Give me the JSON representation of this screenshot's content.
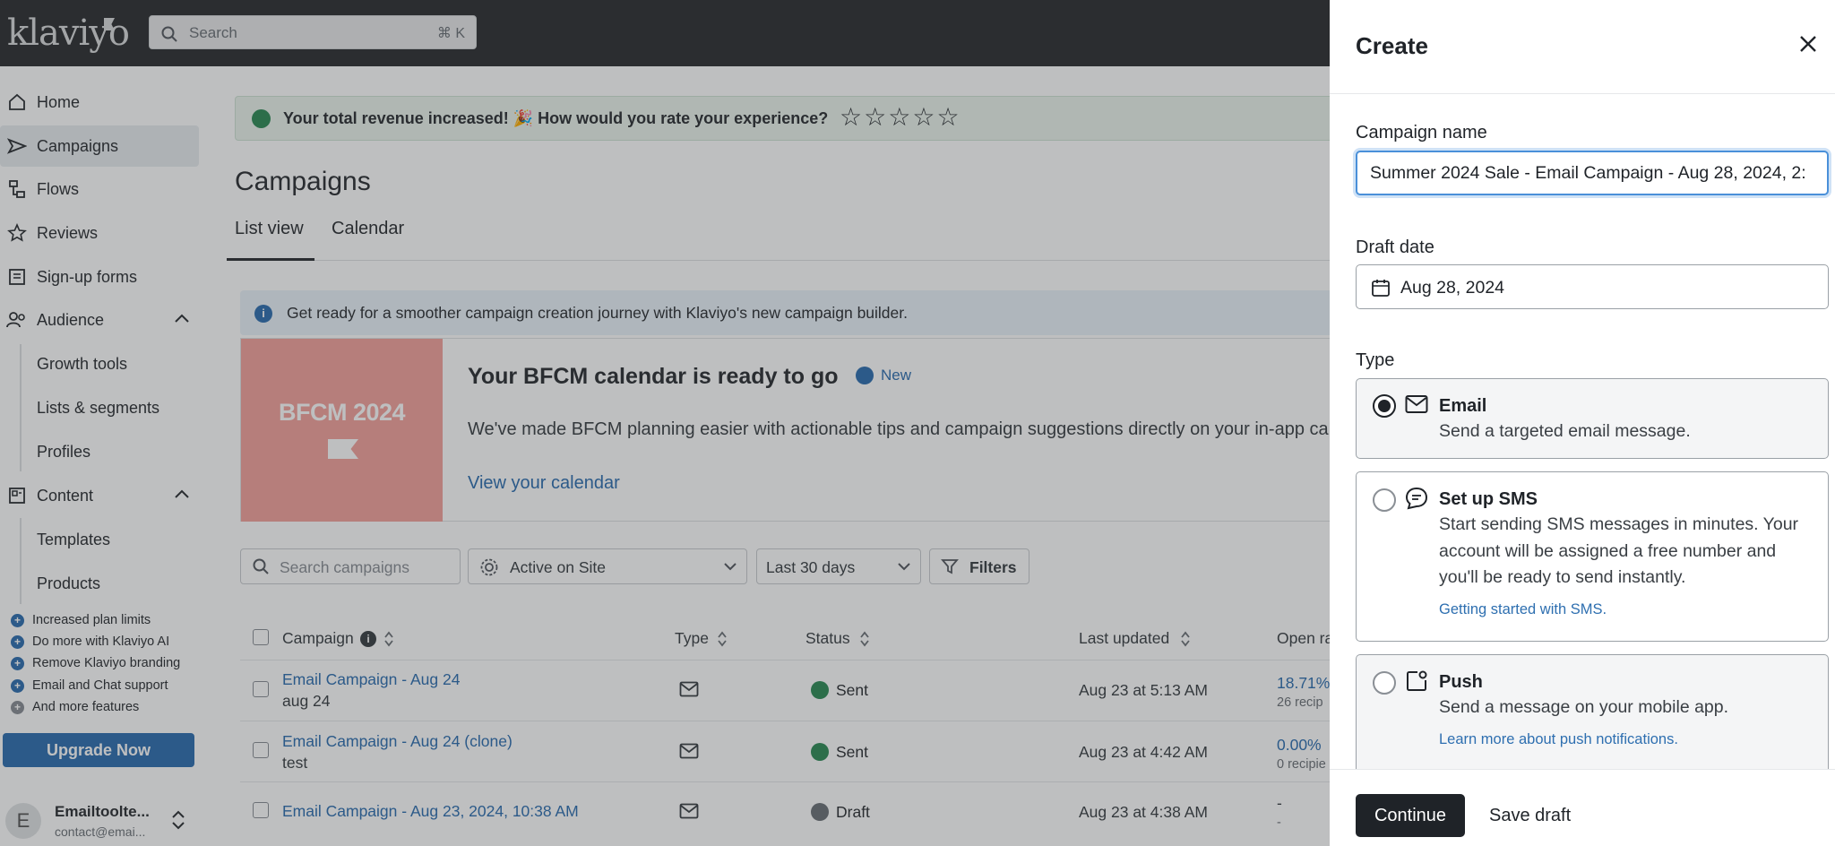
{
  "app": {
    "logo": "klaviyo",
    "search_placeholder": "Search",
    "search_shortcut": "⌘ K"
  },
  "sidebar": {
    "items": [
      {
        "label": "Home",
        "icon": "home-icon"
      },
      {
        "label": "Campaigns",
        "icon": "campaigns-icon"
      },
      {
        "label": "Flows",
        "icon": "flows-icon"
      },
      {
        "label": "Reviews",
        "icon": "star-icon"
      },
      {
        "label": "Sign-up forms",
        "icon": "form-icon"
      },
      {
        "label": "Audience",
        "icon": "audience-icon"
      },
      {
        "label": "Content",
        "icon": "content-icon"
      }
    ],
    "audience_sub": [
      "Growth tools",
      "Lists & segments",
      "Profiles"
    ],
    "content_sub": [
      "Templates",
      "Products"
    ],
    "perks": [
      "Increased plan limits",
      "Do more with Klaviyo AI",
      "Remove Klaviyo branding",
      "Email and Chat support",
      "And more features"
    ],
    "upgrade_label": "Upgrade Now",
    "account": {
      "initial": "E",
      "name": "Emailtoolte...",
      "email": "contact@emai..."
    }
  },
  "main": {
    "toast": "Your total revenue increased! 🎉 How would you rate your experience?",
    "stars": [
      "☆",
      "☆",
      "☆",
      "☆",
      "☆"
    ],
    "title": "Campaigns",
    "tabs": [
      "List view",
      "Calendar"
    ],
    "info_banner": "Get ready for a smoother campaign creation journey with Klaviyo's new campaign builder.",
    "bfcm": {
      "image_text": "BFCM 2024",
      "title": "Your BFCM calendar is ready to go",
      "badge": "New",
      "description": "We've made BFCM planning easier with actionable tips and campaign suggestions directly on your in-app cal",
      "link": "View your calendar"
    },
    "filters": {
      "search_placeholder": "Search campaigns",
      "channel": "Active on Site",
      "range": "Last 30 days",
      "filters_label": "Filters"
    },
    "columns": [
      "Campaign",
      "Type",
      "Status",
      "Last updated",
      "Open ra"
    ],
    "rows": [
      {
        "name": "Email Campaign - Aug 24",
        "sub": "aug 24",
        "status": "Sent",
        "updated": "Aug 23 at 5:13 AM",
        "open": "18.71%",
        "open_sub": "26 recip"
      },
      {
        "name": "Email Campaign - Aug 24 (clone)",
        "sub": "test",
        "status": "Sent",
        "updated": "Aug 23 at 4:42 AM",
        "open": "0.00%",
        "open_sub": "0 recipie"
      },
      {
        "name": "Email Campaign - Aug 23, 2024, 10:38 AM",
        "sub": "",
        "status": "Draft",
        "updated": "Aug 23 at 4:38 AM",
        "open": "-",
        "open_sub": "-"
      }
    ]
  },
  "panel": {
    "title": "Create",
    "campaign_name_label": "Campaign name",
    "campaign_name_value": "Summer 2024 Sale - Email Campaign - Aug 28, 2024, 2:",
    "draft_date_label": "Draft date",
    "draft_date_value": "Aug 28, 2024",
    "type_label": "Type",
    "options": [
      {
        "title": "Email",
        "desc": "Send a targeted email message.",
        "link": "",
        "selected": true
      },
      {
        "title": "Set up SMS",
        "desc": "Start sending SMS messages in minutes. Your account will be assigned a free number and you'll be ready to send instantly.",
        "link": "Getting started with SMS.",
        "selected": false
      },
      {
        "title": "Push",
        "desc": "Send a message on your mobile app.",
        "link": "Learn more about push notifications.",
        "selected": false
      }
    ],
    "continue_label": "Continue",
    "save_draft_label": "Save draft"
  },
  "colors": {
    "accent": "#2e6fb0",
    "dark": "#1f2328",
    "focus": "#4a90d9",
    "success": "#2e8b57"
  }
}
